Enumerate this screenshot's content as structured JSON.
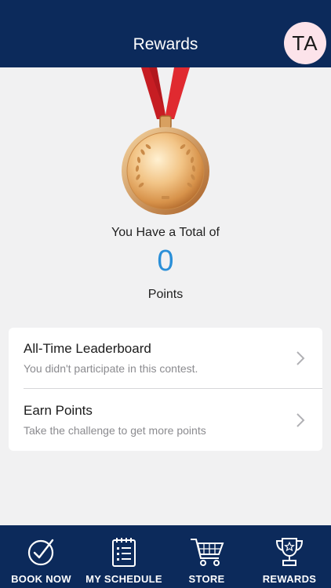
{
  "header": {
    "title": "Rewards",
    "avatar_initials": "TA"
  },
  "summary": {
    "total_label": "You Have a Total of",
    "points": "0",
    "points_label": "Points"
  },
  "menu": [
    {
      "title": "All-Time Leaderboard",
      "subtitle": "You didn't participate in this contest."
    },
    {
      "title": "Earn Points",
      "subtitle": "Take the challenge to get more points"
    }
  ],
  "tabs": [
    {
      "label": "BOOK NOW",
      "icon": "check-circle-icon"
    },
    {
      "label": "MY SCHEDULE",
      "icon": "calendar-icon"
    },
    {
      "label": "STORE",
      "icon": "cart-icon"
    },
    {
      "label": "REWARDS",
      "icon": "trophy-icon"
    }
  ],
  "colors": {
    "header_bg": "#0c2a5b",
    "accent_blue": "#2a8fd8",
    "avatar_bg": "#fce3ea",
    "page_bg": "#f1f1f2"
  }
}
